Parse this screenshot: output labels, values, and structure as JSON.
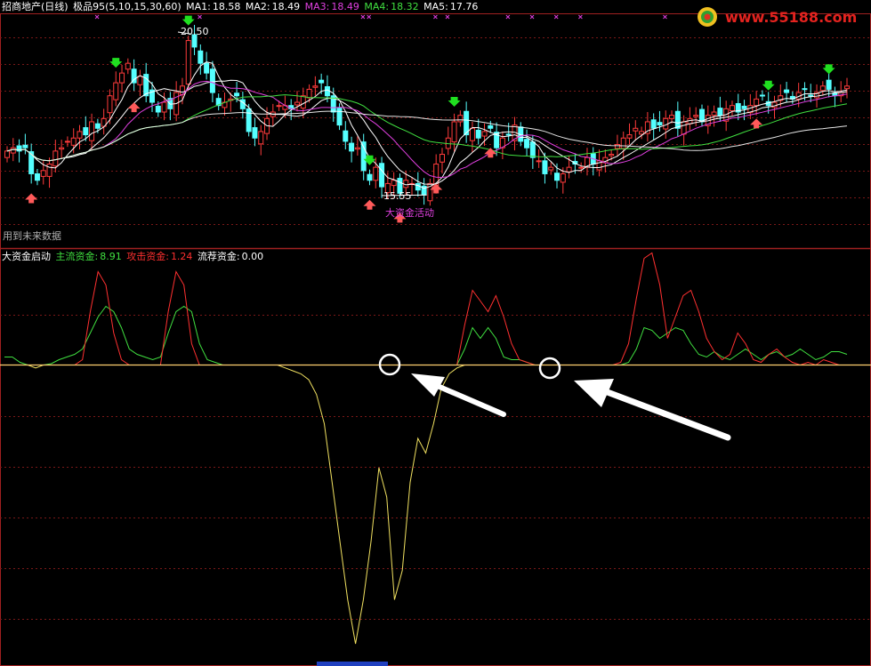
{
  "header": {
    "stock_title": "招商地产(日线)",
    "indicator_name": "极品95(5,10,15,30,60)",
    "ma": [
      {
        "label": "MA1:",
        "value": "18.58",
        "color": "#ffffff"
      },
      {
        "label": "MA2:",
        "value": "18.49",
        "color": "#ffffff"
      },
      {
        "label": "MA3:",
        "value": "18.49",
        "color": "#e040e0"
      },
      {
        "label": "MA4:",
        "value": "18.32",
        "color": "#40e040"
      },
      {
        "label": "MA5:",
        "value": "17.76",
        "color": "#ffffff"
      }
    ]
  },
  "watermark": {
    "site": "www.55188.com"
  },
  "annotations": {
    "high_label": "20.50",
    "low_label": "15.55",
    "signal_label": "大资金活动",
    "future_data_label": "用到未来数据"
  },
  "lower_header": {
    "title": "大资金启动",
    "items": [
      {
        "label": "主流资金:",
        "value": "8.91",
        "color": "#40e040"
      },
      {
        "label": "攻击资金:",
        "value": "1.24",
        "color": "#ff3030"
      },
      {
        "label": "流荐资金:",
        "value": "0.00",
        "color": "#ffffff"
      }
    ]
  },
  "chart_data": [
    {
      "type": "candlestick",
      "series": [
        {
          "name": "MA1"
        },
        {
          "name": "MA2"
        },
        {
          "name": "MA3"
        },
        {
          "name": "MA4"
        },
        {
          "name": "MA5"
        }
      ],
      "close": [
        16.9,
        17.0,
        16.9,
        17.0,
        16.2,
        16.0,
        16.3,
        16.5,
        16.9,
        17.0,
        17.2,
        17.3,
        17.5,
        17.4,
        17.8,
        17.6,
        17.9,
        18.6,
        19.0,
        19.3,
        19.6,
        19.0,
        19.2,
        18.6,
        18.4,
        18.1,
        18.4,
        18.2,
        18.7,
        18.9,
        20.3,
        20.1,
        19.6,
        19.3,
        18.7,
        18.3,
        18.4,
        18.5,
        18.6,
        18.2,
        17.5,
        17.3,
        17.5,
        17.9,
        18.1,
        18.3,
        18.3,
        18.2,
        18.4,
        18.6,
        18.8,
        18.9,
        19.0,
        18.6,
        18.1,
        17.7,
        17.2,
        16.9,
        17.0,
        16.3,
        16.0,
        16.4,
        15.8,
        15.9,
        16.0,
        15.6,
        16.0,
        15.9,
        15.7,
        15.55,
        15.9,
        16.5,
        16.8,
        17.3,
        17.8,
        18.0,
        17.4,
        17.6,
        17.3,
        17.5,
        17.6,
        17.0,
        17.3,
        17.4,
        17.7,
        17.2,
        17.0,
        16.7,
        16.6,
        16.2,
        16.4,
        16.0,
        16.2,
        16.4,
        16.5,
        16.4,
        16.7,
        16.5,
        16.6,
        16.7,
        16.8,
        17.1,
        17.3,
        17.4,
        17.6,
        17.5,
        17.8,
        17.6,
        17.7,
        17.9,
        18.0,
        17.6,
        17.8,
        17.9,
        18.0,
        17.8,
        18.0,
        18.1,
        18.0,
        18.2,
        18.3,
        18.1,
        18.2,
        18.3,
        18.5,
        18.6,
        18.3,
        18.4,
        18.6,
        18.7,
        18.5,
        18.7,
        18.8,
        18.6,
        18.7,
        18.9,
        18.8,
        18.6,
        18.7,
        18.9
      ],
      "high": 20.5,
      "low": 15.55
    },
    {
      "type": "line",
      "series": [
        {
          "name": "主流资金",
          "values": [
            3,
            3,
            1,
            0,
            -1,
            0,
            0.5,
            2,
            3,
            4,
            6,
            12,
            18,
            22,
            20,
            14,
            6,
            4,
            3,
            2,
            3,
            12,
            20,
            22,
            20,
            8,
            2,
            1,
            0,
            0,
            0,
            0,
            0,
            0,
            0,
            0,
            -1,
            -2,
            -3,
            -5,
            -10,
            -20,
            -40,
            -60,
            -80,
            -95,
            -80,
            -60,
            -35,
            -45,
            -80,
            -70,
            -40,
            -25,
            -30,
            -20,
            -8,
            -3,
            -1,
            6,
            14,
            10,
            14,
            10,
            3,
            2,
            2,
            1,
            0,
            0,
            0,
            0,
            0,
            0,
            0,
            0,
            0,
            0,
            0,
            0,
            1,
            6,
            14,
            13,
            10,
            12,
            14,
            13,
            8,
            4,
            3,
            5,
            3,
            2,
            4,
            6,
            4,
            2,
            4,
            5,
            3,
            4,
            6,
            4,
            2,
            3,
            5,
            5,
            4
          ]
        },
        {
          "name": "攻击资金",
          "values": [
            0,
            0,
            0,
            0,
            0,
            0,
            0,
            0,
            0,
            0,
            2,
            20,
            35,
            30,
            12,
            2,
            0,
            0,
            0,
            0,
            0,
            20,
            35,
            30,
            8,
            0,
            0,
            0,
            0,
            0,
            0,
            0,
            0,
            0,
            0,
            0,
            0,
            0,
            0,
            0,
            0,
            0,
            0,
            0,
            0,
            0,
            0,
            0,
            0,
            0,
            0,
            0,
            0,
            0,
            0,
            0,
            0,
            0,
            0,
            15,
            28,
            24,
            20,
            26,
            18,
            8,
            2,
            1,
            0,
            0,
            0,
            0,
            0,
            0,
            0,
            0,
            0,
            0,
            0,
            1,
            8,
            25,
            40,
            42,
            30,
            10,
            18,
            26,
            28,
            20,
            10,
            5,
            2,
            4,
            12,
            8,
            2,
            1,
            4,
            6,
            3,
            1,
            0,
            1,
            0,
            2,
            1,
            0,
            0
          ]
        },
        {
          "name": "流荐资金",
          "values": [
            0
          ]
        }
      ]
    }
  ]
}
